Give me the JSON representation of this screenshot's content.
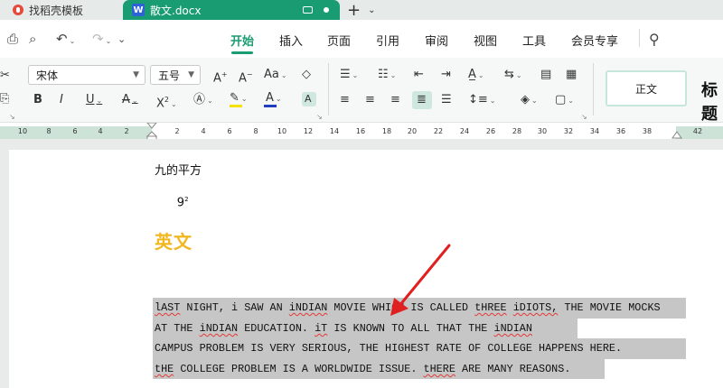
{
  "tabs": {
    "home_label": "找稻壳模板",
    "doc_label": "散文.docx",
    "doc_badge": "W"
  },
  "menu": {
    "items": [
      "开始",
      "插入",
      "页面",
      "引用",
      "审阅",
      "视图",
      "工具",
      "会员专享"
    ],
    "active": "开始"
  },
  "ribbon": {
    "font_name": "宋体",
    "font_size": "五号",
    "style_current": "正文",
    "style_next": "标题",
    "colors": {
      "highlight": "#f5e100",
      "font_color": "#1f3fbf",
      "accent": "#1a9c73"
    }
  },
  "ruler": {
    "left_ticks": [
      "10",
      "8",
      "6",
      "4",
      "2"
    ],
    "right_ticks": [
      "2",
      "4",
      "6",
      "8",
      "10",
      "12",
      "14",
      "16",
      "18",
      "20",
      "22",
      "24",
      "26",
      "28",
      "30",
      "32",
      "34",
      "36",
      "38"
    ],
    "end_tick": "42"
  },
  "document": {
    "line1": "九的平方",
    "line2_base": "9",
    "line2_sup": "2",
    "heading": "英文",
    "paragraph": [
      "lAST NIGHT, i SAW AN iNDIAN MOVIE WHICH IS CALLED tHREE iDIOTS, THE MOVIE MOCKS",
      "AT THE iNDIAN EDUCATION. iT IS KNOWN TO ALL THAT THE iNDIAN",
      "CAMPUS PROBLEM IS VERY SERIOUS, THE HIGHEST RATE OF COLLEGE HAPPENS HERE.",
      "tHE COLLEGE PROBLEM IS A WORLDWIDE ISSUE. tHERE ARE MANY REASONS."
    ]
  },
  "annotation": {
    "arrow_color": "#e02020"
  }
}
